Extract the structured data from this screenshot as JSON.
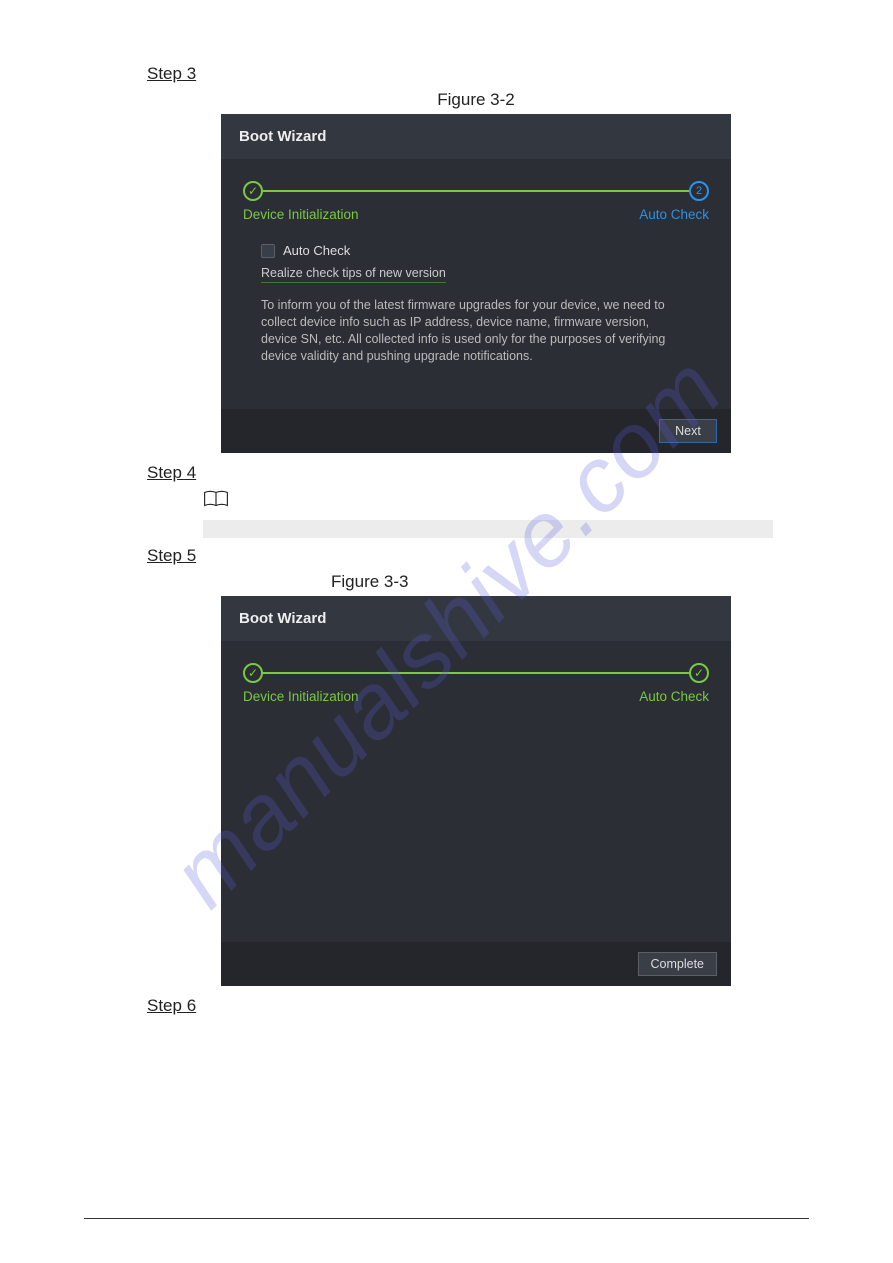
{
  "watermark": "manualshive.com",
  "steps": {
    "s3": "Step 3",
    "s4": "Step 4",
    "s5": "Step 5",
    "s6": "Step 6"
  },
  "figures": {
    "f32": "Figure 3-2",
    "f33": "Figure 3-3"
  },
  "wizard1": {
    "title": "Boot Wizard",
    "step1_label": "Device Initialization",
    "step2_label": "Auto Check",
    "step2_num": "2",
    "checkbox_label": "Auto Check",
    "subline": "Realize check tips of new version",
    "info": "To inform you of the latest firmware upgrades for your device, we need to collect device info such as IP address, device name, firmware version, device SN, etc. All collected info is used only for the purposes of verifying device validity and pushing upgrade notifications.",
    "next_btn": "Next"
  },
  "wizard2": {
    "title": "Boot Wizard",
    "step1_label": "Device Initialization",
    "step2_label": "Auto Check",
    "complete_btn": "Complete"
  },
  "colors": {
    "accent_green": "#7ac943",
    "accent_blue": "#2d91e6",
    "panel_bg": "#2b2e35"
  }
}
